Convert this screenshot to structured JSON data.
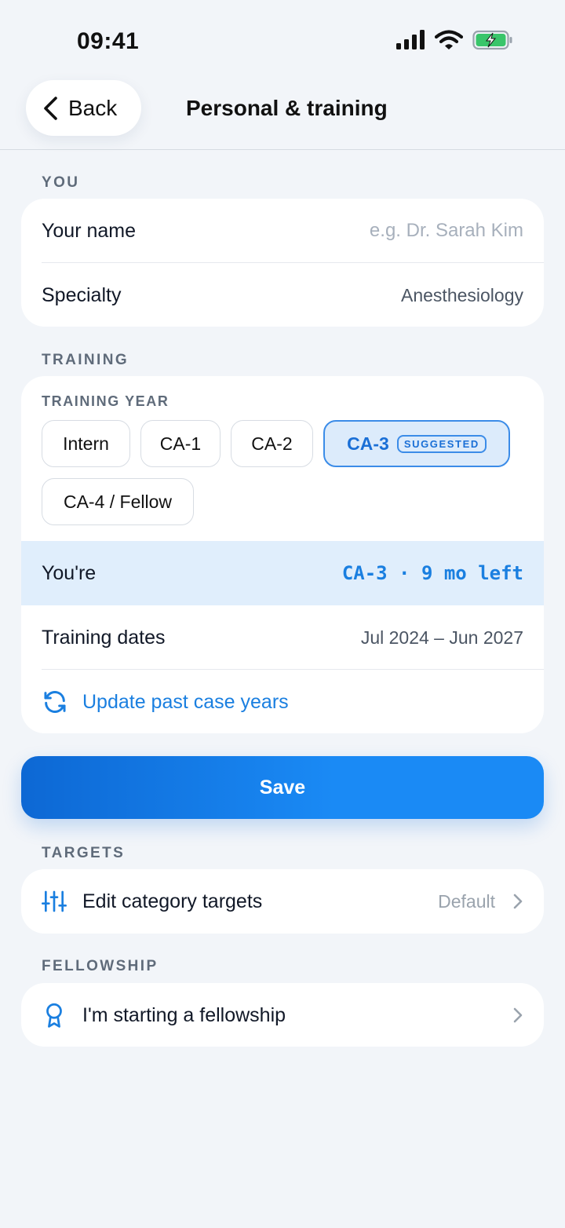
{
  "status": {
    "time": "09:41"
  },
  "header": {
    "back_label": "Back",
    "title": "Personal & training"
  },
  "sections": {
    "you": "YOU",
    "training": "TRAINING",
    "targets": "TARGETS",
    "fellowship": "FELLOWSHIP"
  },
  "you_card": {
    "name_label": "Your name",
    "name_placeholder": "e.g. Dr. Sarah Kim",
    "specialty_label": "Specialty",
    "specialty_value": "Anesthesiology"
  },
  "training_card": {
    "year_label": "TRAINING YEAR",
    "chips": [
      "Intern",
      "CA-1",
      "CA-2",
      "CA-3",
      "CA-4 / Fellow"
    ],
    "selected_chip": "CA-3",
    "suggested_badge": "SUGGESTED",
    "status_label": "You're",
    "status_value": "CA-3 · 9 mo left",
    "dates_label": "Training dates",
    "dates_value": "Jul 2024 – Jun 2027",
    "update_link": "Update past case years"
  },
  "save_label": "Save",
  "targets_card": {
    "label": "Edit category targets",
    "value": "Default"
  },
  "fellowship_card": {
    "label": "I'm starting a fellowship"
  },
  "colors": {
    "accent": "#1a7fe0",
    "background": "#f2f5f9",
    "highlight": "#e0eefc"
  },
  "icons": {
    "back": "chevron-left-icon",
    "refresh": "refresh-icon",
    "sliders": "sliders-icon",
    "award": "award-icon",
    "chevron": "chevron-right-icon",
    "signal": "signal-icon",
    "wifi": "wifi-icon",
    "battery": "battery-charging-icon"
  }
}
